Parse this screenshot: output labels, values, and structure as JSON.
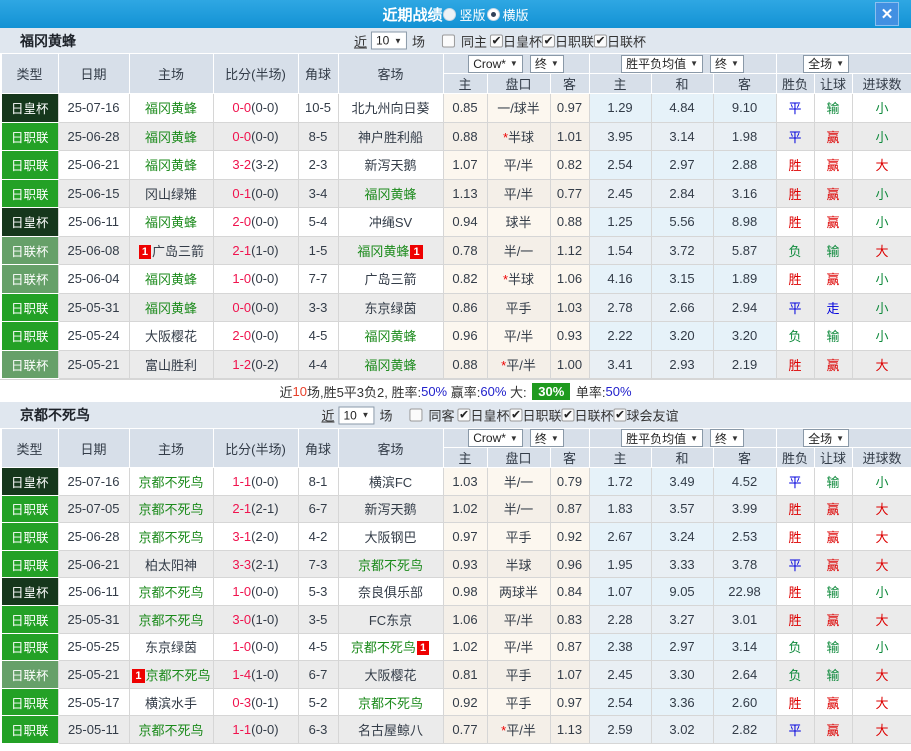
{
  "titlebar": {
    "title": "近期战绩",
    "radio_vertical": "竖版",
    "radio_horizontal": "横版",
    "close": "✕"
  },
  "filter_labels": {
    "near": "近",
    "count": "10",
    "games": "场"
  },
  "table_header": {
    "type": "类型",
    "date": "日期",
    "home": "主场",
    "score": "比分(半场)",
    "corner": "角球",
    "away": "客场",
    "odds_select": "Crow*",
    "odds_final": "终",
    "avg_select": "胜平负均值",
    "avg_final": "终",
    "scope_select": "全场",
    "o_home": "主",
    "o_hcap": "盘口",
    "o_away": "客",
    "a_home": "主",
    "a_draw": "和",
    "a_away": "客",
    "wdl": "胜负",
    "let": "让球",
    "goals": "进球数"
  },
  "colors": {
    "type": {
      "日皇杯": "#16371c",
      "日职联": "#23a126",
      "日联杯": "#66a069"
    },
    "result": {
      "胜": "#dd0000",
      "平": "#0000dd",
      "负": "#0f8a3c",
      "赢": "#dd0000",
      "输": "#0f8a3c",
      "走": "#0000dd",
      "大": "#dd0000",
      "小": "#0f8a3c"
    },
    "score_red": "#f0134e",
    "team_self_green": "#1b8a1b",
    "badge_red": "#ee0000"
  },
  "sections": [
    {
      "team": "福冈黄蜂",
      "filter": {
        "same": "同主",
        "same_checked": false,
        "cups": [
          {
            "label": "日皇杯",
            "checked": true
          },
          {
            "label": "日职联",
            "checked": true
          },
          {
            "label": "日联杯",
            "checked": true
          }
        ]
      },
      "rows": [
        {
          "type": "日皇杯",
          "date": "25-07-16",
          "home": "福冈黄蜂",
          "hself": true,
          "hbadge": "",
          "ft": "0-0",
          "ht": "(0-0)",
          "corner": "10-5",
          "away": "北九州向日葵",
          "aself": false,
          "abadge": "",
          "oh": "0.85",
          "hcap": "一/球半",
          "oa": "0.97",
          "ah": "1.29",
          "ad": "4.84",
          "aa": "9.10",
          "wdl": "平",
          "let": "输",
          "goal": "小"
        },
        {
          "type": "日职联",
          "date": "25-06-28",
          "home": "福冈黄蜂",
          "hself": true,
          "hbadge": "",
          "ft": "0-0",
          "ht": "(0-0)",
          "corner": "8-5",
          "away": "神户胜利船",
          "aself": false,
          "abadge": "",
          "oh": "0.88",
          "hcap": "*半球",
          "oa": "1.01",
          "ah": "3.95",
          "ad": "3.14",
          "aa": "1.98",
          "wdl": "平",
          "let": "赢",
          "goal": "小"
        },
        {
          "type": "日职联",
          "date": "25-06-21",
          "home": "福冈黄蜂",
          "hself": true,
          "hbadge": "",
          "ft": "3-2",
          "ht": "(3-2)",
          "corner": "2-3",
          "away": "新泻天鹅",
          "aself": false,
          "abadge": "",
          "oh": "1.07",
          "hcap": "平/半",
          "oa": "0.82",
          "ah": "2.54",
          "ad": "2.97",
          "aa": "2.88",
          "wdl": "胜",
          "let": "赢",
          "goal": "大"
        },
        {
          "type": "日职联",
          "date": "25-06-15",
          "home": "冈山绿雉",
          "hself": false,
          "hbadge": "",
          "ft": "0-1",
          "ht": "(0-0)",
          "corner": "3-4",
          "away": "福冈黄蜂",
          "aself": true,
          "abadge": "",
          "oh": "1.13",
          "hcap": "平/半",
          "oa": "0.77",
          "ah": "2.45",
          "ad": "2.84",
          "aa": "3.16",
          "wdl": "胜",
          "let": "赢",
          "goal": "小"
        },
        {
          "type": "日皇杯",
          "date": "25-06-11",
          "home": "福冈黄蜂",
          "hself": true,
          "hbadge": "",
          "ft": "2-0",
          "ht": "(0-0)",
          "corner": "5-4",
          "away": "冲绳SV",
          "aself": false,
          "abadge": "",
          "oh": "0.94",
          "hcap": "球半",
          "oa": "0.88",
          "ah": "1.25",
          "ad": "5.56",
          "aa": "8.98",
          "wdl": "胜",
          "let": "赢",
          "goal": "小"
        },
        {
          "type": "日联杯",
          "date": "25-06-08",
          "home": "广岛三箭",
          "hself": false,
          "hbadge": "1",
          "ft": "2-1",
          "ht": "(1-0)",
          "corner": "1-5",
          "away": "福冈黄蜂",
          "aself": true,
          "abadge": "1",
          "oh": "0.78",
          "hcap": "半/一",
          "oa": "1.12",
          "ah": "1.54",
          "ad": "3.72",
          "aa": "5.87",
          "wdl": "负",
          "let": "输",
          "goal": "大"
        },
        {
          "type": "日联杯",
          "date": "25-06-04",
          "home": "福冈黄蜂",
          "hself": true,
          "hbadge": "",
          "ft": "1-0",
          "ht": "(0-0)",
          "corner": "7-7",
          "away": "广岛三箭",
          "aself": false,
          "abadge": "",
          "oh": "0.82",
          "hcap": "*半球",
          "oa": "1.06",
          "ah": "4.16",
          "ad": "3.15",
          "aa": "1.89",
          "wdl": "胜",
          "let": "赢",
          "goal": "小"
        },
        {
          "type": "日职联",
          "date": "25-05-31",
          "home": "福冈黄蜂",
          "hself": true,
          "hbadge": "",
          "ft": "0-0",
          "ht": "(0-0)",
          "corner": "3-3",
          "away": "东京绿茵",
          "aself": false,
          "abadge": "",
          "oh": "0.86",
          "hcap": "平手",
          "oa": "1.03",
          "ah": "2.78",
          "ad": "2.66",
          "aa": "2.94",
          "wdl": "平",
          "let": "走",
          "goal": "小"
        },
        {
          "type": "日职联",
          "date": "25-05-24",
          "home": "大阪樱花",
          "hself": false,
          "hbadge": "",
          "ft": "2-0",
          "ht": "(0-0)",
          "corner": "4-5",
          "away": "福冈黄蜂",
          "aself": true,
          "abadge": "",
          "oh": "0.96",
          "hcap": "平/半",
          "oa": "0.93",
          "ah": "2.22",
          "ad": "3.20",
          "aa": "3.20",
          "wdl": "负",
          "let": "输",
          "goal": "小"
        },
        {
          "type": "日联杯",
          "date": "25-05-21",
          "home": "富山胜利",
          "hself": false,
          "hbadge": "",
          "ft": "1-2",
          "ht": "(0-2)",
          "corner": "4-4",
          "away": "福冈黄蜂",
          "aself": true,
          "abadge": "",
          "oh": "0.88",
          "hcap": "*平/半",
          "oa": "1.00",
          "ah": "3.41",
          "ad": "2.93",
          "aa": "2.19",
          "wdl": "胜",
          "let": "赢",
          "goal": "大"
        }
      ],
      "summary_parts": [
        {
          "text": "近",
          "style": "plain"
        },
        {
          "text": "10",
          "style": "red"
        },
        {
          "text": "场,胜5平3负2, 胜率:",
          "style": "plain"
        },
        {
          "text": "50%",
          "style": "blue"
        },
        {
          "text": " 赢率:",
          "style": "plain"
        },
        {
          "text": "60%",
          "style": "blue"
        },
        {
          "text": " 大: ",
          "style": "plain"
        },
        {
          "text": "30%",
          "style": "badge"
        },
        {
          "text": " 单率:",
          "style": "plain"
        },
        {
          "text": "50%",
          "style": "blue"
        }
      ]
    },
    {
      "team": "京都不死鸟",
      "filter": {
        "same": "同客",
        "same_checked": false,
        "cups": [
          {
            "label": "日皇杯",
            "checked": true
          },
          {
            "label": "日职联",
            "checked": true
          },
          {
            "label": "日联杯",
            "checked": true
          },
          {
            "label": "球会友谊",
            "checked": true
          }
        ]
      },
      "rows": [
        {
          "type": "日皇杯",
          "date": "25-07-16",
          "home": "京都不死鸟",
          "hself": true,
          "hbadge": "",
          "ft": "1-1",
          "ht": "(0-0)",
          "corner": "8-1",
          "away": "横滨FC",
          "aself": false,
          "abadge": "",
          "oh": "1.03",
          "hcap": "半/一",
          "oa": "0.79",
          "ah": "1.72",
          "ad": "3.49",
          "aa": "4.52",
          "wdl": "平",
          "let": "输",
          "goal": "小"
        },
        {
          "type": "日职联",
          "date": "25-07-05",
          "home": "京都不死鸟",
          "hself": true,
          "hbadge": "",
          "ft": "2-1",
          "ht": "(2-1)",
          "corner": "6-7",
          "away": "新泻天鹅",
          "aself": false,
          "abadge": "",
          "oh": "1.02",
          "hcap": "半/一",
          "oa": "0.87",
          "ah": "1.83",
          "ad": "3.57",
          "aa": "3.99",
          "wdl": "胜",
          "let": "赢",
          "goal": "大"
        },
        {
          "type": "日职联",
          "date": "25-06-28",
          "home": "京都不死鸟",
          "hself": true,
          "hbadge": "",
          "ft": "3-1",
          "ht": "(2-0)",
          "corner": "4-2",
          "away": "大阪钢巴",
          "aself": false,
          "abadge": "",
          "oh": "0.97",
          "hcap": "平手",
          "oa": "0.92",
          "ah": "2.67",
          "ad": "3.24",
          "aa": "2.53",
          "wdl": "胜",
          "let": "赢",
          "goal": "大"
        },
        {
          "type": "日职联",
          "date": "25-06-21",
          "home": "柏太阳神",
          "hself": false,
          "hbadge": "",
          "ft": "3-3",
          "ht": "(2-1)",
          "corner": "7-3",
          "away": "京都不死鸟",
          "aself": true,
          "abadge": "",
          "oh": "0.93",
          "hcap": "半球",
          "oa": "0.96",
          "ah": "1.95",
          "ad": "3.33",
          "aa": "3.78",
          "wdl": "平",
          "let": "赢",
          "goal": "大"
        },
        {
          "type": "日皇杯",
          "date": "25-06-11",
          "home": "京都不死鸟",
          "hself": true,
          "hbadge": "",
          "ft": "1-0",
          "ht": "(0-0)",
          "corner": "5-3",
          "away": "奈良俱乐部",
          "aself": false,
          "abadge": "",
          "oh": "0.98",
          "hcap": "两球半",
          "oa": "0.84",
          "ah": "1.07",
          "ad": "9.05",
          "aa": "22.98",
          "wdl": "胜",
          "let": "输",
          "goal": "小"
        },
        {
          "type": "日职联",
          "date": "25-05-31",
          "home": "京都不死鸟",
          "hself": true,
          "hbadge": "",
          "ft": "3-0",
          "ht": "(1-0)",
          "corner": "3-5",
          "away": "FC东京",
          "aself": false,
          "abadge": "",
          "oh": "1.06",
          "hcap": "平/半",
          "oa": "0.83",
          "ah": "2.28",
          "ad": "3.27",
          "aa": "3.01",
          "wdl": "胜",
          "let": "赢",
          "goal": "大"
        },
        {
          "type": "日职联",
          "date": "25-05-25",
          "home": "东京绿茵",
          "hself": false,
          "hbadge": "",
          "ft": "1-0",
          "ht": "(0-0)",
          "corner": "4-5",
          "away": "京都不死鸟",
          "aself": true,
          "abadge": "1",
          "oh": "1.02",
          "hcap": "平/半",
          "oa": "0.87",
          "ah": "2.38",
          "ad": "2.97",
          "aa": "3.14",
          "wdl": "负",
          "let": "输",
          "goal": "小"
        },
        {
          "type": "日联杯",
          "date": "25-05-21",
          "home": "京都不死鸟",
          "hself": true,
          "hbadge": "1",
          "ft": "1-4",
          "ht": "(1-0)",
          "corner": "6-7",
          "away": "大阪樱花",
          "aself": false,
          "abadge": "",
          "oh": "0.81",
          "hcap": "平手",
          "oa": "1.07",
          "ah": "2.45",
          "ad": "3.30",
          "aa": "2.64",
          "wdl": "负",
          "let": "输",
          "goal": "大"
        },
        {
          "type": "日职联",
          "date": "25-05-17",
          "home": "横滨水手",
          "hself": false,
          "hbadge": "",
          "ft": "0-3",
          "ht": "(0-1)",
          "corner": "5-2",
          "away": "京都不死鸟",
          "aself": true,
          "abadge": "",
          "oh": "0.92",
          "hcap": "平手",
          "oa": "0.97",
          "ah": "2.54",
          "ad": "3.36",
          "aa": "2.60",
          "wdl": "胜",
          "let": "赢",
          "goal": "大"
        },
        {
          "type": "日职联",
          "date": "25-05-11",
          "home": "京都不死鸟",
          "hself": true,
          "hbadge": "",
          "ft": "1-1",
          "ht": "(0-0)",
          "corner": "6-3",
          "away": "名古屋鲸八",
          "aself": false,
          "abadge": "",
          "oh": "0.77",
          "hcap": "*平/半",
          "oa": "1.13",
          "ah": "2.59",
          "ad": "3.02",
          "aa": "2.82",
          "wdl": "平",
          "let": "赢",
          "goal": "大"
        }
      ]
    }
  ]
}
